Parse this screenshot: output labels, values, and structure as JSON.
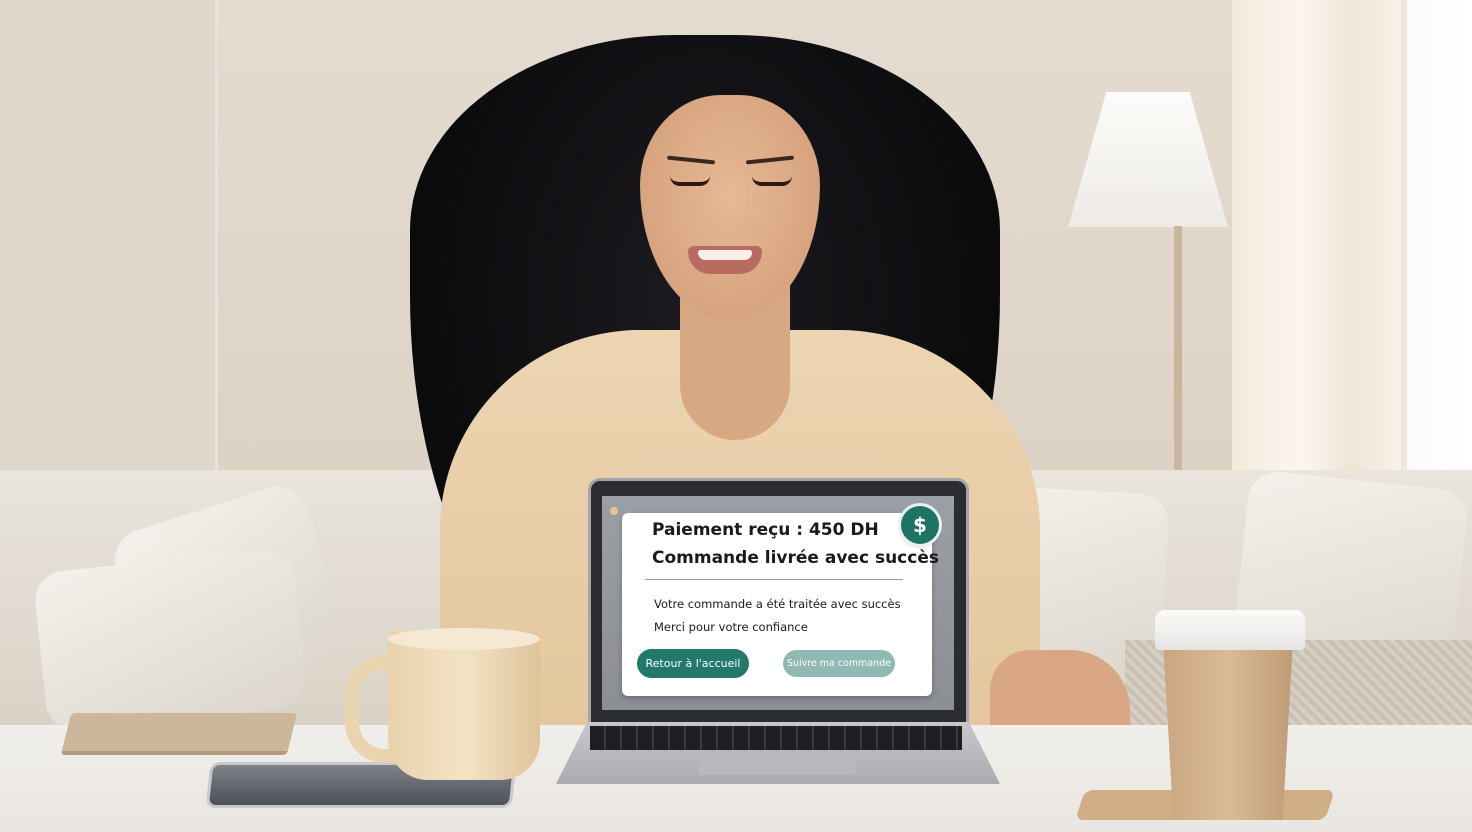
{
  "notification": {
    "title": "Paiement reçu : 450 DH",
    "subtitle": "Commande livrée avec succès",
    "message_line1": "Votre commande a été traitée avec succès",
    "message_line2": "Merci pour votre confiance",
    "primary_button": "Retour à l'accueil",
    "secondary_button": "Suivre ma commande",
    "badge_icon": "dollar-icon",
    "badge_glyph": "$"
  },
  "colors": {
    "accent": "#23786c",
    "accent_light": "#8fb9b2",
    "badge": "#1e7364"
  }
}
